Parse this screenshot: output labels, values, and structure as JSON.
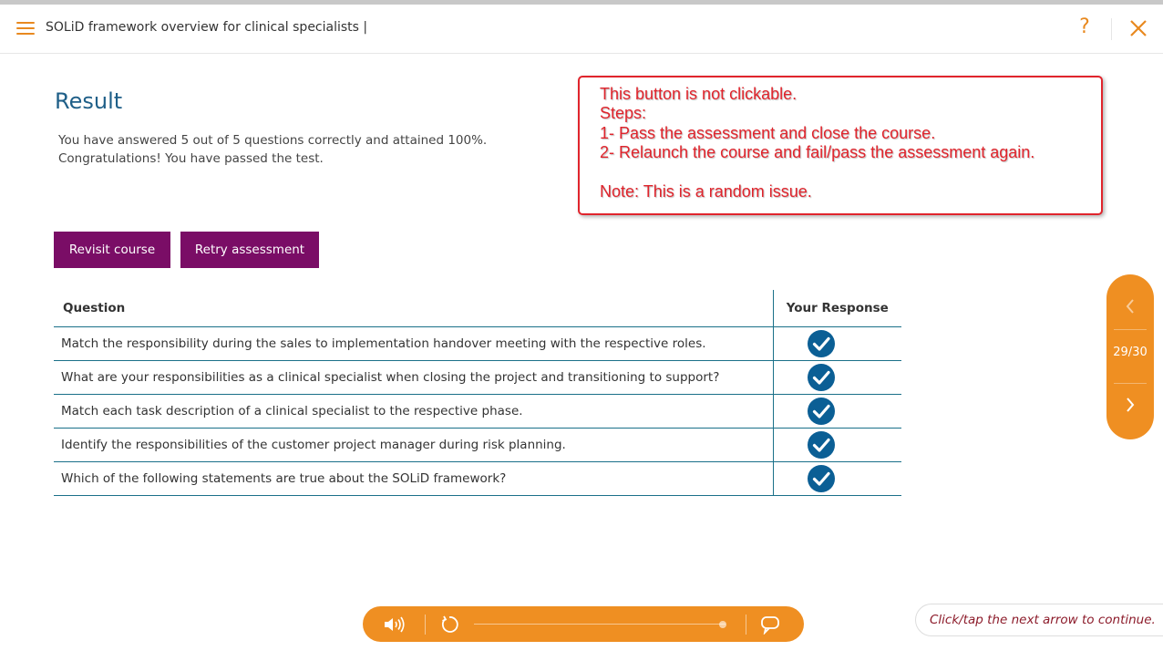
{
  "header": {
    "course_title": "SOLiD framework overview for clinical specialists |",
    "help_label": "?"
  },
  "result": {
    "title": "Result",
    "line1": "You have answered 5 out of 5 questions correctly and attained 100%.",
    "line2": "Congratulations! You have passed the test."
  },
  "annotation": {
    "lines": [
      "This button is not clickable.",
      "Steps:",
      "1- Pass the assessment and close the course.",
      "2- Relaunch the course and fail/pass the assessment again.",
      "Note: This is a random issue."
    ],
    "color": "#e0242c"
  },
  "buttons": {
    "revisit": "Revisit course",
    "retry": "Retry assessment"
  },
  "table": {
    "headers": [
      "Question",
      "Your Response"
    ],
    "rows": [
      {
        "question": "Match the responsibility during the sales to implementation handover meeting with the respective roles.",
        "response": "check-icon"
      },
      {
        "question": "What are your responsibilities as a clinical specialist when closing the project and transitioning to support?",
        "response": "check-icon"
      },
      {
        "question": "Match each task description of a clinical specialist to the respective phase.",
        "response": "check-icon"
      },
      {
        "question": "Identify the responsibilities of the customer project manager during risk planning.",
        "response": "check-icon"
      },
      {
        "question": "Which of the following statements are true about the SOLiD framework?",
        "response": "check-icon"
      }
    ]
  },
  "navigation": {
    "page_counter": "29/30"
  },
  "media_bar": {
    "progress": 1.0
  },
  "hint": {
    "text": "Click/tap the next arrow to continue."
  },
  "colors": {
    "accent_orange": "#ef8f22",
    "button_purple": "#7a0d66",
    "title_blue": "#1f5f88",
    "check_blue": "#0b5f95"
  }
}
